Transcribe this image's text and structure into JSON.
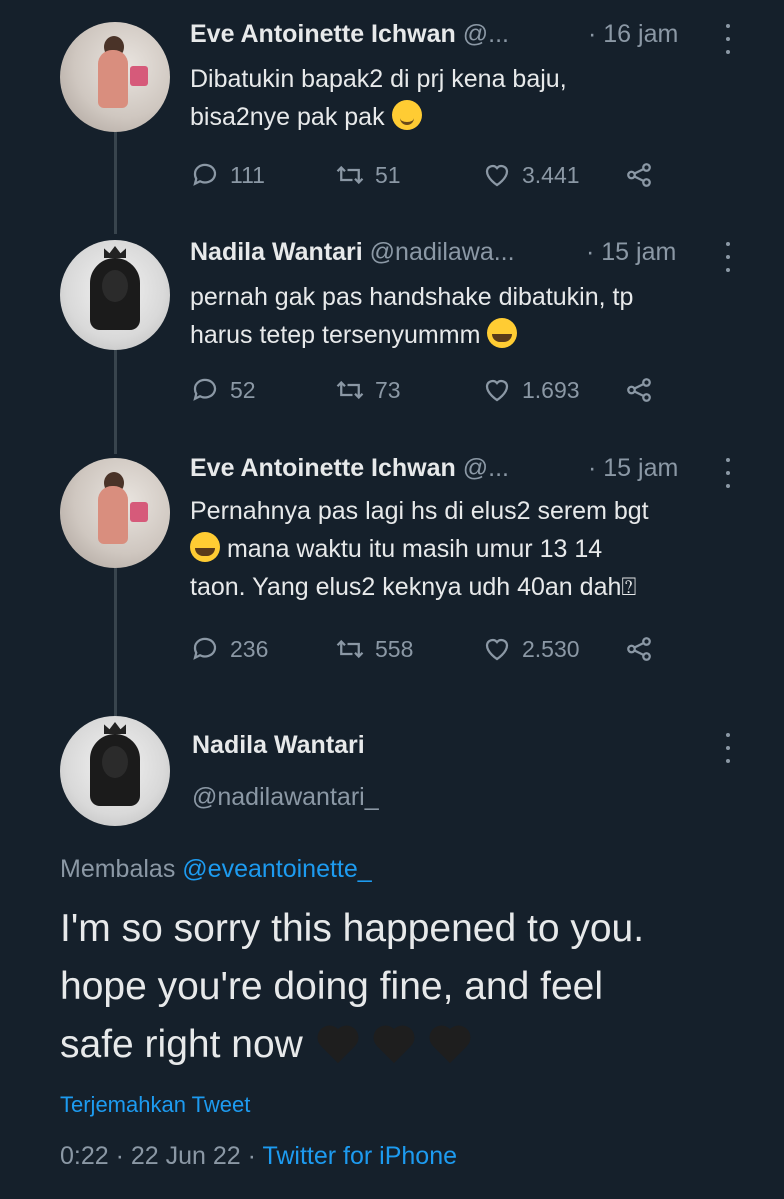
{
  "tweets": [
    {
      "name": "Eve Antoinette Ichwan",
      "handle": "@...",
      "time": "· 16 jam",
      "text_line1": "Dibatukin bapak2 di prj kena baju,",
      "text_line2": "bisa2nye pak pak",
      "replies": "111",
      "retweets": "51",
      "likes": "3.441"
    },
    {
      "name": "Nadila Wantari",
      "handle": "@nadilawa...",
      "time": "· 15 jam",
      "text_line1": "pernah gak pas handshake dibatukin, tp",
      "text_line2": "harus tetep tersenyummm",
      "replies": "52",
      "retweets": "73",
      "likes": "1.693"
    },
    {
      "name": "Eve Antoinette Ichwan",
      "handle": "@...",
      "time": "· 15 jam",
      "text_line1": "Pernahnya pas lagi hs di elus2 serem bgt",
      "text_line2": "mana waktu itu masih umur 13 14",
      "text_line3": "taon. Yang elus2 keknya udh 40an dah⍰",
      "replies": "236",
      "retweets": "558",
      "likes": "2.530"
    }
  ],
  "main_tweet": {
    "name": "Nadila Wantari",
    "handle": "@nadilawantari_",
    "replying_prefix": "Membalas",
    "replying_to": "@eveantoinette_",
    "text_line1": "I'm so sorry this happened to you.",
    "text_line2": "hope you're doing fine, and feel",
    "text_line3": "safe right now",
    "translate": "Terjemahkan Tweet",
    "timestamp": "0:22 · 22 Jun 22 ·",
    "source": "Twitter for iPhone"
  },
  "icons": {
    "reply": "reply-icon",
    "retweet": "retweet-icon",
    "like": "heart-icon",
    "share": "share-icon",
    "more": "more-icon",
    "emoji_smile": "slightly-smiling-face-emoji",
    "emoji_cry": "loudly-crying-face-emoji",
    "emoji_heart": "black-heart-emoji"
  },
  "colors": {
    "background": "#15202b",
    "text": "#e7e9ea",
    "muted": "#8b98a5",
    "link": "#1d9bf0"
  }
}
